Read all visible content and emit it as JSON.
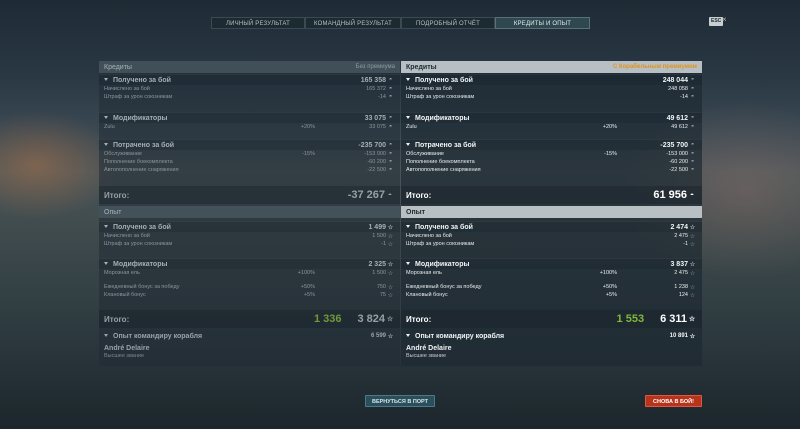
{
  "tabs": [
    "ЛИЧНЫЙ РЕЗУЛЬТАТ",
    "КОМАНДНЫЙ РЕЗУЛЬТАТ",
    "ПОДРОБНЫЙ ОТЧЁТ",
    "КРЕДИТЫ И ОПЫТ"
  ],
  "esc": "ESC",
  "left": {
    "credits_title": "Кредиты",
    "credits_tag": "Без премиума",
    "earned": "Получено за бой",
    "earned_val": "165 358",
    "accrued": "Начислено за бой",
    "accrued_val": "165 372",
    "penalty": "Штраф за урон союзникам",
    "penalty_val": "-14",
    "mods": "Модификаторы",
    "mods_val": "33 075",
    "zulu": "Zulu",
    "zulu_pct": "+20%",
    "zulu_val": "33 075",
    "spent": "Потрачено за бой",
    "spent_val": "-235 700",
    "service": "Обслуживание",
    "service_pct": "-15%",
    "service_val": "-153 000",
    "ammo": "Пополнение боекомплекта",
    "ammo_val": "-60 200",
    "supplies": "Автопополнение снаряжения",
    "supplies_val": "-22 500",
    "total": "Итого:",
    "total_val": "-37 267",
    "exp_title": "Опыт",
    "exp_earned": "Получено за бой",
    "exp_earned_val": "1 499",
    "exp_accrued": "Начислено за бой",
    "exp_accrued_val": "1 500",
    "exp_penalty": "Штраф за урон союзникам",
    "exp_penalty_val": "-1",
    "exp_mods": "Модификаторы",
    "exp_mods_val": "2 325",
    "flag": "Морозная ель",
    "flag_pct": "+100%",
    "flag_val": "1 500",
    "daily": "Ежедневный бонус за победу",
    "daily_pct": "+50%",
    "daily_val": "750",
    "clan": "Клановый бонус",
    "clan_pct": "+5%",
    "clan_val": "75",
    "exp_total": "Итого:",
    "exp_total_free": "1 336",
    "exp_total_val": "3 824",
    "captain": "Опыт командиру корабля",
    "captain_val": "6 599",
    "cap_name": "André Delaire",
    "cap_rank": "Высшее звание"
  },
  "right": {
    "credits_title": "Кредиты",
    "credits_tag": "С Корабельным премиумом",
    "earned": "Получено за бой",
    "earned_val": "248 044",
    "accrued": "Начислено за бой",
    "accrued_val": "248 058",
    "penalty": "Штраф за урон союзникам",
    "penalty_val": "-14",
    "mods": "Модификаторы",
    "mods_val": "49 612",
    "zulu": "Zulu",
    "zulu_pct": "+20%",
    "zulu_val": "49 612",
    "spent": "Потрачено за бой",
    "spent_val": "-235 700",
    "service": "Обслуживание",
    "service_pct": "-15%",
    "service_val": "-153 000",
    "ammo": "Пополнение боекомплекта",
    "ammo_val": "-60 200",
    "supplies": "Автопополнение снаряжения",
    "supplies_val": "-22 500",
    "total": "Итого:",
    "total_val": "61 956",
    "exp_title": "Опыт",
    "exp_earned": "Получено за бой",
    "exp_earned_val": "2 474",
    "exp_accrued": "Начислено за бой",
    "exp_accrued_val": "2 475",
    "exp_penalty": "Штраф за урон союзникам",
    "exp_penalty_val": "-1",
    "exp_mods": "Модификаторы",
    "exp_mods_val": "3 837",
    "flag": "Морозная ель",
    "flag_pct": "+100%",
    "flag_val": "2 475",
    "daily": "Ежедневный бонус за победу",
    "daily_pct": "+50%",
    "daily_val": "1 238",
    "clan": "Клановый бонус",
    "clan_pct": "+5%",
    "clan_val": "124",
    "exp_total": "Итого:",
    "exp_total_free": "1 553",
    "exp_total_val": "6 311",
    "captain": "Опыт командиру корабля",
    "captain_val": "10 891",
    "cap_name": "André Delaire",
    "cap_rank": "Высшее звание"
  },
  "buttons": {
    "port": "ВЕРНУТЬСЯ В ПОРТ",
    "battle": "СНОВА В БОЙ!"
  },
  "icons": {
    "credit": "credit-icon",
    "exp": "star-icon",
    "free_exp": "star-outline-icon"
  }
}
